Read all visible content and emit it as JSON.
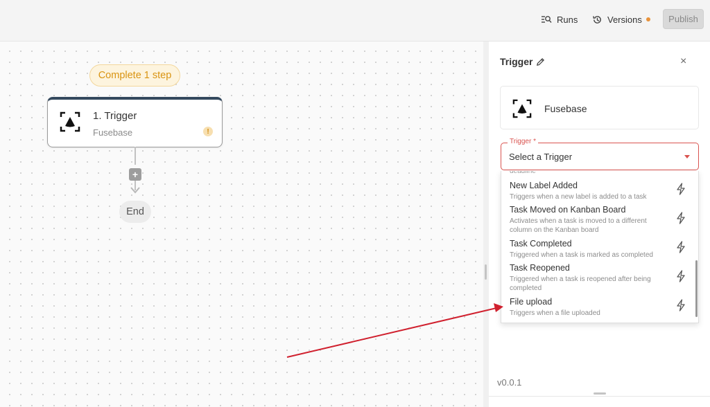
{
  "header": {
    "runs_label": "Runs",
    "versions_label": "Versions",
    "publish_label": "Publish",
    "versions_dot_color": "#e8923a"
  },
  "canvas": {
    "status_badge": "Complete 1 step",
    "trigger_node": {
      "title": "1. Trigger",
      "subtitle": "Fusebase",
      "warning_symbol": "!"
    },
    "add_symbol": "+",
    "end_label": "End"
  },
  "panel": {
    "title": "Trigger",
    "close_symbol": "×",
    "app_name": "Fusebase",
    "select": {
      "label": "Trigger *",
      "placeholder": "Select a Trigger"
    },
    "cut_off_text": "deadline",
    "options": [
      {
        "title": "New Label Added",
        "desc": "Triggers when a new label is added to a task"
      },
      {
        "title": "Task Moved on Kanban Board",
        "desc": "Activates when a task is moved to a different column on the Kanban board"
      },
      {
        "title": "Task Completed",
        "desc": "Triggered when a task is marked as completed"
      },
      {
        "title": "Task Reopened",
        "desc": "Triggered when a task is reopened after being completed"
      },
      {
        "title": "File upload",
        "desc": "Triggers when a file uploaded"
      }
    ],
    "version": "v0.0.1"
  },
  "colors": {
    "accent_red": "#d9534f",
    "annotation_arrow": "#d0202e",
    "badge_text": "#d99412",
    "node_header": "#34495e"
  },
  "icons": [
    "runs-icon",
    "history-icon",
    "pencil-icon",
    "close-icon",
    "fusebase-logo-icon",
    "bolt-icon",
    "chevron-down-icon",
    "warning-icon",
    "arrow-down-icon"
  ]
}
